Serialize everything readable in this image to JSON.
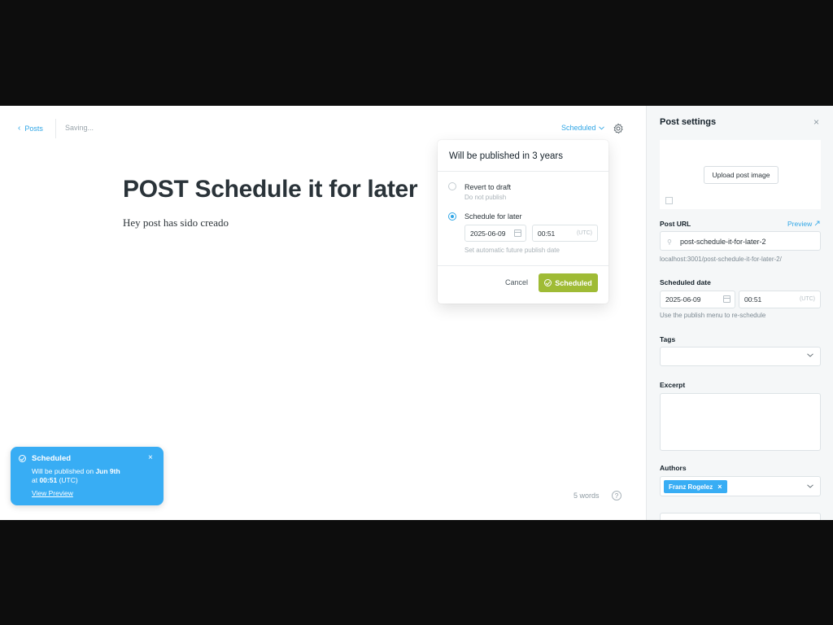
{
  "editor": {
    "back_label": "Posts",
    "saving_text": "Saving...",
    "status_label": "Scheduled",
    "post_title": "POST Schedule it for later",
    "post_body": "Hey post has sido creado",
    "word_count": "5 words",
    "help_label": "?"
  },
  "publish_popover": {
    "title": "Will be published in 3 years",
    "option_revert_label": "Revert to draft",
    "option_revert_sub": "Do not publish",
    "option_schedule_label": "Schedule for later",
    "date_value": "2025-06-09",
    "time_value": "00:51",
    "timezone": "(UTC)",
    "schedule_hint": "Set automatic future publish date",
    "cancel_label": "Cancel",
    "scheduled_label": "Scheduled",
    "selected_option": "schedule"
  },
  "toast": {
    "title": "Scheduled",
    "line1_prefix": "Will be published on ",
    "line1_date": "Jun 9th",
    "line2_prefix": "at ",
    "line2_time": "00:51",
    "line2_suffix": " (UTC)",
    "link_label": "View Preview",
    "close_label": "×"
  },
  "settings_panel": {
    "title": "Post settings",
    "close_label": "×",
    "upload_label": "Upload post image",
    "url_label": "Post URL",
    "preview_label": "Preview",
    "url_value": "post-schedule-it-for-later-2",
    "url_full": "localhost:3001/post-schedule-it-for-later-2/",
    "scheduled_date_label": "Scheduled date",
    "scheduled_date_value": "2025-06-09",
    "scheduled_time_value": "00:51",
    "timezone": "(UTC)",
    "scheduled_hint": "Use the publish menu to re-schedule",
    "tags_label": "Tags",
    "excerpt_label": "Excerpt",
    "authors_label": "Authors",
    "author_name": "Franz Rogelez",
    "chip_remove": "×"
  },
  "colors": {
    "accent_blue": "#30a6e6",
    "toast_blue": "#38adf4",
    "scheduled_green": "#9fbb35"
  },
  "icons": [
    "chevron-left-icon",
    "chevron-down-icon",
    "gear-icon",
    "help-icon",
    "calendar-icon",
    "check-circle-icon",
    "close-icon",
    "link-icon",
    "image-icon",
    "external-link-icon"
  ]
}
